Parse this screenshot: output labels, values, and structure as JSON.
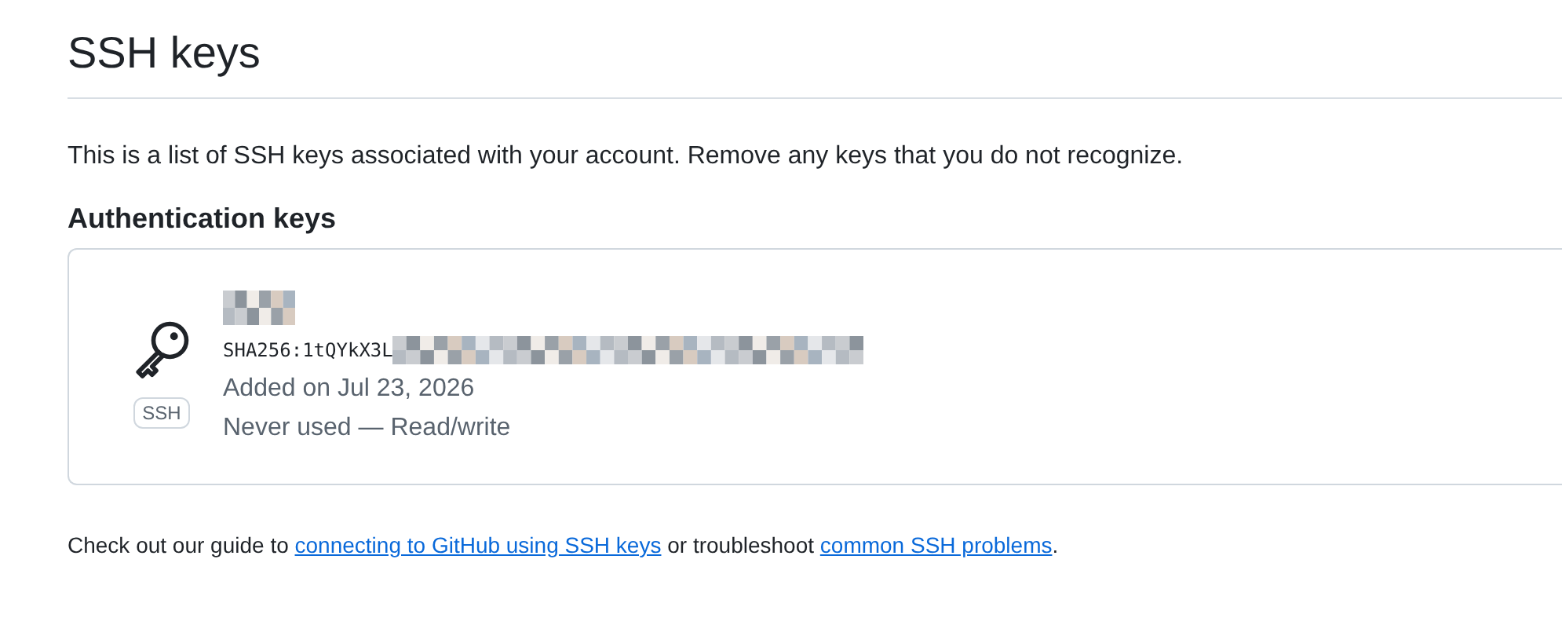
{
  "page": {
    "title": "SSH keys",
    "intro": "This is a list of SSH keys associated with your account. Remove any keys that you do not recognize."
  },
  "section": {
    "title": "Authentication keys",
    "keys": [
      {
        "fingerprint": "SHA256:1tQYkX3L",
        "badge": "SSH",
        "added": "Added on Jul 23, 2026",
        "usage": "Never used — Read/write"
      }
    ]
  },
  "footer": [
    {
      "kind": "text",
      "text": "Check out our guide to "
    },
    {
      "kind": "link",
      "text": "connecting to GitHub using SSH keys"
    },
    {
      "kind": "text",
      "text": " or troubleshoot "
    },
    {
      "kind": "link",
      "text": "common SSH problems"
    },
    {
      "kind": "text",
      "text": "."
    }
  ]
}
